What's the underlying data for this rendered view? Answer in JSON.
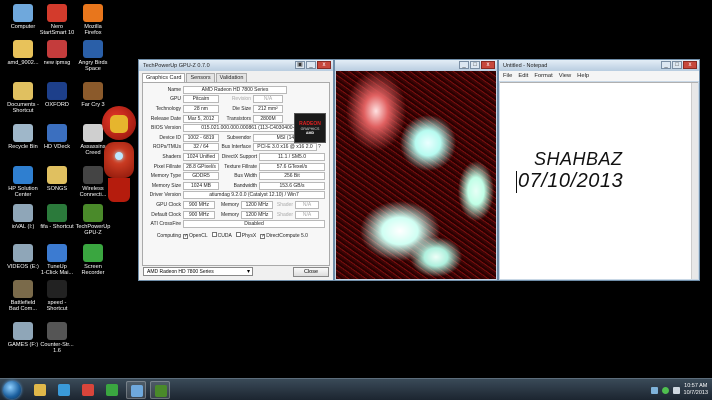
{
  "desktop_icons": [
    {
      "name": "computer-icon",
      "label": "Computer",
      "color": "#6fa8dc"
    },
    {
      "name": "nero-icon",
      "label": "Nero\nStartSmart 10",
      "color": "#d33b2c"
    },
    {
      "name": "firefox-icon",
      "label": "Mozilla\nFirefox",
      "color": "#e8761c"
    },
    {
      "name": "folder-icon",
      "label": "amd_9002...",
      "color": "#e8c25a"
    },
    {
      "name": "ipmsg-icon",
      "label": "new ipmsg",
      "color": "#c43c3c"
    },
    {
      "name": "angry-birds-icon",
      "label": "Angry Birds\nSpace",
      "color": "#2a5fa8"
    },
    {
      "name": "documents-shortcut-icon",
      "label": "Documents -\nShortcut",
      "color": "#e0c060"
    },
    {
      "name": "oxford-icon",
      "label": "OXFORD",
      "color": "#1d3f8a"
    },
    {
      "name": "far-cry-icon",
      "label": "Far Cry 3",
      "color": "#8b5a2b"
    },
    {
      "name": "recycle-bin-icon",
      "label": "Recycle Bin",
      "color": "#9fb7c9"
    },
    {
      "name": "hd-vdeck-icon",
      "label": "HD VDeck",
      "color": "#3b6fbf"
    },
    {
      "name": "assassins-creed-icon",
      "label": "Assassins\nCreed",
      "color": "#cfcfcf"
    },
    {
      "name": "hp-solution-center-icon",
      "label": "HP Solution\nCenter",
      "color": "#2f7fd0"
    },
    {
      "name": "songs-icon",
      "label": "SONGS",
      "color": "#e0c060"
    },
    {
      "name": "wireless-icon",
      "label": "Wireless\nConnecti...",
      "color": "#444"
    },
    {
      "name": "drive-icon",
      "label": "ioVAL (I:)",
      "color": "#8fa6b8"
    },
    {
      "name": "fifa-shortcut-icon",
      "label": "fifa - Shortcut",
      "color": "#2b7a3b"
    },
    {
      "name": "techpowerup-icon",
      "label": "TechPowerUp\nGPU-Z",
      "color": "#4a8a2a"
    },
    {
      "name": "drive-icon",
      "label": "VIDEOS (E:)",
      "color": "#8fa6b8"
    },
    {
      "name": "tuneup-icon",
      "label": "TuneUp\n1-Click Mai...",
      "color": "#3c7bd1"
    },
    {
      "name": "screen-recorder-icon",
      "label": "Screen\nRecorder",
      "color": "#3aa640"
    },
    {
      "name": "battlefield-icon",
      "label": "Battlefield\nBad Com...",
      "color": "#7a6a4a"
    },
    {
      "name": "speed-shortcut-icon",
      "label": "speed -\nShortcut",
      "color": "#222"
    },
    {
      "name": "drive-icon",
      "label": "GAMES (F:)",
      "color": "#8fa6b8"
    },
    {
      "name": "counter-strike-icon",
      "label": "Counter-Str...\n1.6",
      "color": "#555"
    }
  ],
  "gpuz": {
    "title": "TechPowerUp GPU-Z 0.7.0",
    "tabs": [
      "Graphics Card",
      "Sensors",
      "Validation"
    ],
    "logo_text_1": "RADEON",
    "logo_text_2": "GRAPHICS",
    "logo_text_3": "AMD",
    "rows": {
      "name": {
        "label": "Name",
        "value": "AMD Radeon HD 7800 Series"
      },
      "gpu": {
        "label": "GPU",
        "value": "Pitcairn",
        "sub": "Revision",
        "value2": "N/A"
      },
      "technology": {
        "label": "Technology",
        "value": "28 nm",
        "sub": "Die Size",
        "value2": "212 mm²"
      },
      "release": {
        "label": "Release Date",
        "value": "Mar 5, 2012",
        "sub": "Transistors",
        "value2": "2800M"
      },
      "bios": {
        "label": "BIOS Version",
        "value": "015.021.000.000.000861 (113-C4030400-X00)"
      },
      "device": {
        "label": "Device ID",
        "value": "1002 - 6819",
        "sub": "Subvendor",
        "value2": "MSI (1462)"
      },
      "rops": {
        "label": "ROPs/TMUs",
        "value": "32 / 64",
        "sub": "Bus Interface",
        "value2": "PCI-E 3.0 x16 @ x16 2.0"
      },
      "shaders": {
        "label": "Shaders",
        "value": "1024 Unified",
        "sub": "DirectX Support",
        "value2": "11.1 / SM5.0"
      },
      "pixel": {
        "label": "Pixel Fillrate",
        "value": "28.8 GPixel/s",
        "sub": "Texture Fillrate",
        "value2": "57.6 GTexel/s"
      },
      "memtype": {
        "label": "Memory Type",
        "value": "GDDR5",
        "sub": "Bus Width",
        "value2": "256 Bit"
      },
      "memsize": {
        "label": "Memory Size",
        "value": "1024 MB",
        "sub": "Bandwidth",
        "value2": "153.6 GB/s"
      },
      "driver": {
        "label": "Driver Version",
        "value": "atiumdag 9.2.0.0 (Catalyst 12.10) / Win7"
      },
      "gpuclock": {
        "label": "GPU Clock",
        "value": "900 MHz",
        "sub": "Memory",
        "value2": "1200 MHz",
        "sub2": "Shader",
        "value3": "N/A"
      },
      "defclock": {
        "label": "Default Clock",
        "value": "900 MHz",
        "sub": "Memory",
        "value2": "1200 MHz",
        "sub2": "Shader",
        "value3": "N/A"
      },
      "crossfire": {
        "label": "ATI CrossFire",
        "value": "Disabled"
      }
    },
    "computing": {
      "label": "Computing",
      "items": [
        {
          "label": "OpenCL",
          "checked": "✓"
        },
        {
          "label": "CUDA",
          "checked": ""
        },
        {
          "label": "PhysX",
          "checked": ""
        },
        {
          "label": "DirectCompute 5.0",
          "checked": "✓"
        }
      ]
    },
    "gpu_select": "AMD Radeon HD 7800 Series",
    "close_label": "Close"
  },
  "notepad": {
    "title": "Untitled - Notepad",
    "menu": [
      "File",
      "Edit",
      "Format",
      "View",
      "Help"
    ],
    "line1": "SHAHBAZ",
    "line2": "07/10/2013"
  },
  "taskbar": {
    "time": "10:57 AM",
    "date": "10/7/2013",
    "items": [
      {
        "name": "explorer-taskbar-icon",
        "color": "#e0b84a",
        "active": false
      },
      {
        "name": "media-player-taskbar-icon",
        "color": "#3a9ad9",
        "active": false
      },
      {
        "name": "chrome-taskbar-icon",
        "color": "#d9453b",
        "active": false
      },
      {
        "name": "media-center-taskbar-icon",
        "color": "#3aa640",
        "active": false
      },
      {
        "name": "window-taskbar-icon",
        "color": "#6fa8dc",
        "active": true
      },
      {
        "name": "gpuz-taskbar-icon",
        "color": "#4a8a2a",
        "active": true
      }
    ]
  }
}
